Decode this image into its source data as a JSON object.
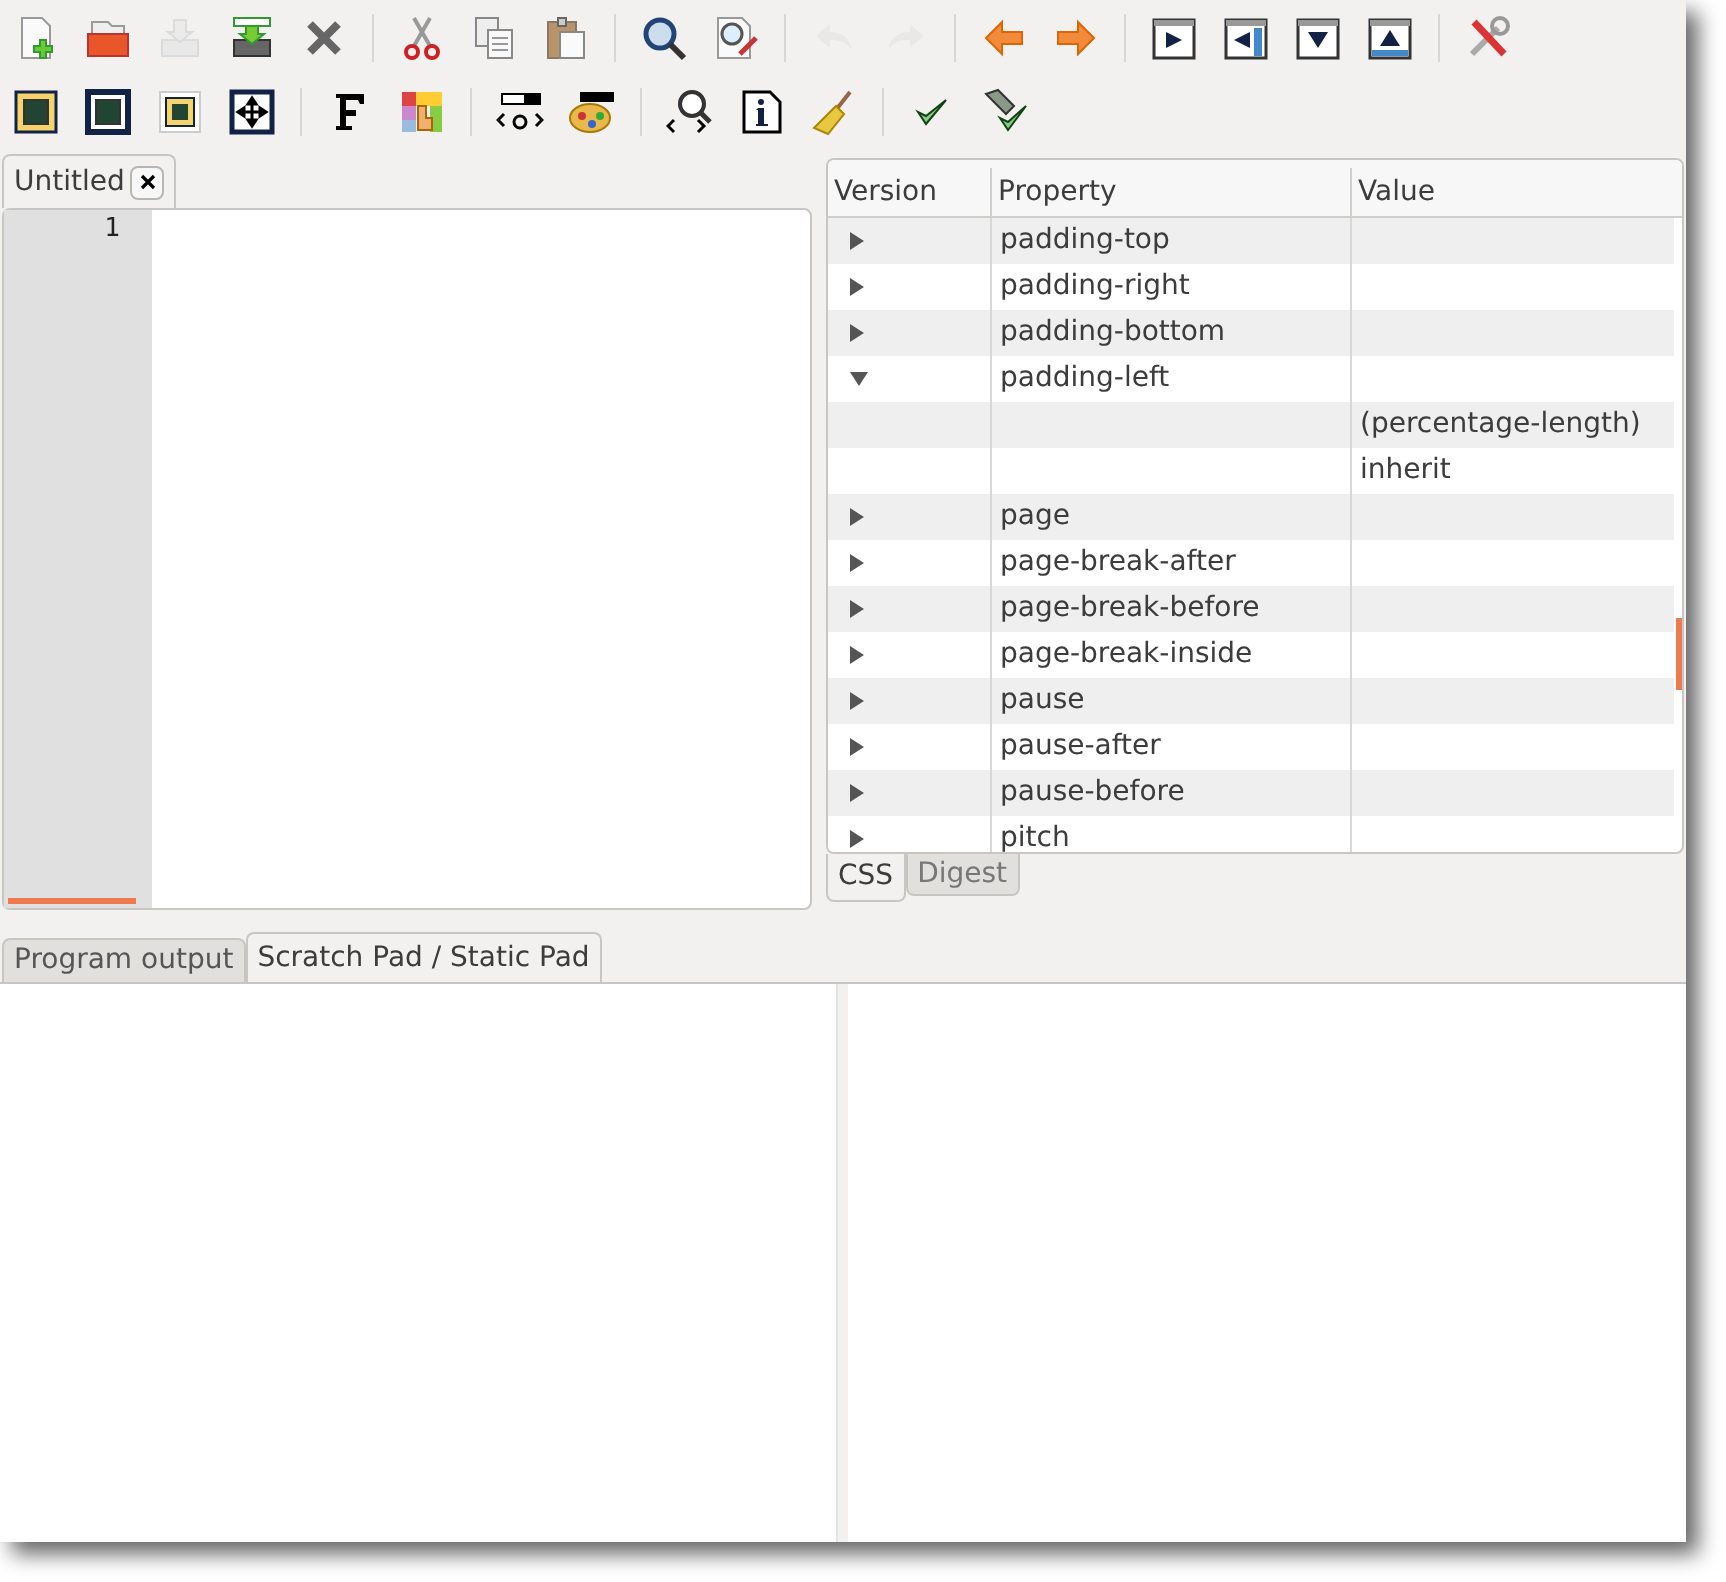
{
  "toolbar_rows": [
    [
      {
        "kind": "new",
        "disabled": false
      },
      {
        "kind": "open",
        "disabled": false
      },
      {
        "kind": "save",
        "disabled": true
      },
      {
        "kind": "saveas",
        "disabled": false
      },
      {
        "kind": "close",
        "disabled": false
      },
      {
        "kind": "sep"
      },
      {
        "kind": "cut",
        "disabled": false
      },
      {
        "kind": "copy",
        "disabled": false
      },
      {
        "kind": "paste",
        "disabled": false
      },
      {
        "kind": "sep"
      },
      {
        "kind": "find",
        "disabled": false
      },
      {
        "kind": "replace",
        "disabled": false
      },
      {
        "kind": "sep"
      },
      {
        "kind": "undo",
        "disabled": true
      },
      {
        "kind": "redo",
        "disabled": true
      },
      {
        "kind": "sep"
      },
      {
        "kind": "back",
        "disabled": false
      },
      {
        "kind": "forward",
        "disabled": false
      },
      {
        "kind": "sep"
      },
      {
        "kind": "winright",
        "disabled": false
      },
      {
        "kind": "winleft",
        "disabled": false
      },
      {
        "kind": "windown",
        "disabled": false
      },
      {
        "kind": "winup",
        "disabled": false
      },
      {
        "kind": "sep"
      },
      {
        "kind": "tools",
        "disabled": false
      }
    ],
    [
      {
        "kind": "frameyellow",
        "disabled": false
      },
      {
        "kind": "frameblue",
        "disabled": false
      },
      {
        "kind": "frameinner",
        "disabled": false
      },
      {
        "kind": "move",
        "disabled": false
      },
      {
        "kind": "sep"
      },
      {
        "kind": "font",
        "disabled": false
      },
      {
        "kind": "palette",
        "disabled": false
      },
      {
        "kind": "sep"
      },
      {
        "kind": "tag",
        "disabled": false
      },
      {
        "kind": "colortag",
        "disabled": false
      },
      {
        "kind": "sep"
      },
      {
        "kind": "findtag",
        "disabled": false
      },
      {
        "kind": "info",
        "disabled": false
      },
      {
        "kind": "broom",
        "disabled": false
      },
      {
        "kind": "sep"
      },
      {
        "kind": "check",
        "disabled": false
      },
      {
        "kind": "checkall",
        "disabled": false
      }
    ]
  ],
  "editor": {
    "tabs": [
      {
        "label": "Untitled",
        "selected": true
      }
    ],
    "line_numbers": [
      "1"
    ]
  },
  "css_table": {
    "columns": [
      "Version",
      "Property",
      "Value"
    ],
    "rows": [
      {
        "expandable": true,
        "expanded": false,
        "property": "padding-top"
      },
      {
        "expandable": true,
        "expanded": false,
        "property": "padding-right"
      },
      {
        "expandable": true,
        "expanded": false,
        "property": "padding-bottom"
      },
      {
        "expandable": true,
        "expanded": true,
        "property": "padding-left"
      },
      {
        "expandable": false,
        "value": "(percentage-length)"
      },
      {
        "expandable": false,
        "value": "inherit"
      },
      {
        "expandable": true,
        "expanded": false,
        "property": "page"
      },
      {
        "expandable": true,
        "expanded": false,
        "property": "page-break-after"
      },
      {
        "expandable": true,
        "expanded": false,
        "property": "page-break-before"
      },
      {
        "expandable": true,
        "expanded": false,
        "property": "page-break-inside"
      },
      {
        "expandable": true,
        "expanded": false,
        "property": "pause"
      },
      {
        "expandable": true,
        "expanded": false,
        "property": "pause-after"
      },
      {
        "expandable": true,
        "expanded": false,
        "property": "pause-before"
      },
      {
        "expandable": true,
        "expanded": false,
        "property": "pitch"
      }
    ],
    "tabs": [
      {
        "label": "CSS",
        "selected": true
      },
      {
        "label": "Digest",
        "selected": false
      }
    ]
  },
  "bottom_tabs": [
    {
      "label": "Program output",
      "selected": false
    },
    {
      "label": "Scratch Pad / Static Pad",
      "selected": true
    }
  ]
}
